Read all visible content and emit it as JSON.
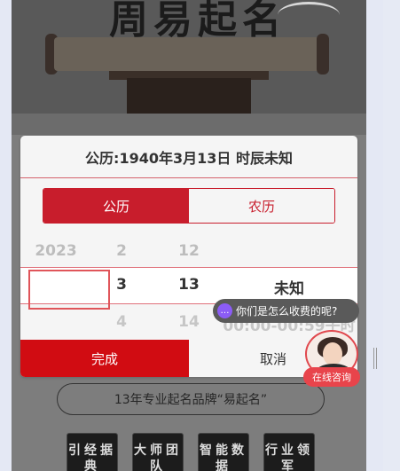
{
  "modal": {
    "title": "公历:1940年3月13日 时辰未知",
    "tabs": [
      {
        "label": "公历",
        "active": true
      },
      {
        "label": "农历",
        "active": false
      }
    ],
    "picker": {
      "columns": [
        {
          "prev": "2023",
          "current": "",
          "next": ""
        },
        {
          "prev": "2",
          "current": "3",
          "next": "4"
        },
        {
          "prev": "12",
          "current": "13",
          "next": "14"
        },
        {
          "prev": "",
          "current": "未知",
          "next": "00:00-00:59子时"
        }
      ]
    },
    "done_label": "完成",
    "cancel_label": "取消"
  },
  "background": {
    "banner_title": "周易起名",
    "slogan": "13年专业起名品牌“易起名”",
    "badges": [
      "引经据典",
      "大师团队",
      "智能数据",
      "行业领军"
    ]
  },
  "chat": {
    "bubble_text": "你们是怎么收费的呢?",
    "consult_label": "在线咨询",
    "icon": "chat-icon"
  },
  "colors": {
    "accent_red": "#c81d2c",
    "done_red": "#d10c12",
    "chat_icon": "#8b5cf6"
  }
}
